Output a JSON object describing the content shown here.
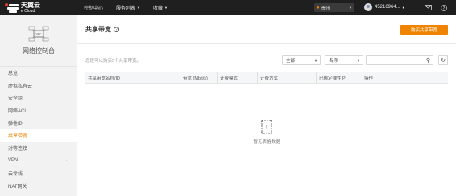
{
  "topbar": {
    "logo_cn": "天翼云",
    "logo_en": "e Cloud",
    "nav": [
      "控制中心",
      "服务列表",
      "收藏"
    ],
    "region": "贵州",
    "user": "4521696​4..."
  },
  "sidebar": {
    "title": "网络控制台",
    "items": [
      {
        "label": "总览"
      },
      {
        "label": "虚拟私有云"
      },
      {
        "label": "安全组"
      },
      {
        "label": "网络ACL"
      },
      {
        "label": "弹性IP"
      },
      {
        "label": "共享带宽"
      },
      {
        "label": "对等连接"
      },
      {
        "label": "VPN"
      },
      {
        "label": "云专线"
      },
      {
        "label": "NAT网关"
      }
    ],
    "active_index": 5
  },
  "main": {
    "title": "共享带宽",
    "buy_button": "购买共享带宽",
    "hint": "您还可以购买5个共享带宽。",
    "filter_select": "全部",
    "name_select": "名称",
    "search_value": "",
    "table": {
      "columns": [
        "共享带宽名称/ID",
        "带宽 (Mbit/s)",
        "计费模式",
        "计费方式",
        "已绑定弹性IP",
        "操作"
      ]
    },
    "empty_text": "暂无表格数据"
  },
  "colors": {
    "accent": "#f08300",
    "topbar": "#1f1f1f",
    "sidebar": "#f2f2f2"
  }
}
